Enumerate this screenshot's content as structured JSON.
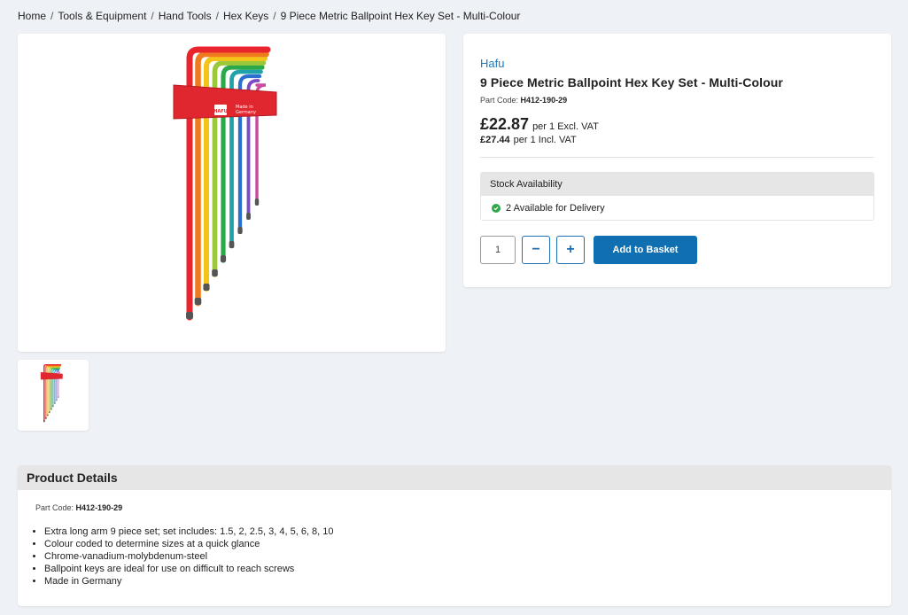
{
  "breadcrumb": {
    "items": [
      "Home",
      "Tools & Equipment",
      "Hand Tools",
      "Hex Keys"
    ],
    "current": "9 Piece Metric Ballpoint Hex Key Set - Multi-Colour",
    "separator": "/"
  },
  "product": {
    "brand": "Hafu",
    "title": "9 Piece Metric Ballpoint Hex Key Set - Multi-Colour",
    "part_code_label": "Part Code:",
    "part_code": "H412-190-29",
    "price_excl": "£22.87",
    "price_excl_unit": "per 1 Excl. VAT",
    "price_incl": "£27.44",
    "price_incl_unit": "per 1 Incl. VAT"
  },
  "stock": {
    "header": "Stock Availability",
    "status": "2 Available for Delivery",
    "status_color": "#2ea84a"
  },
  "basket": {
    "quantity": "1",
    "minus_label": "−",
    "plus_label": "+",
    "add_label": "Add to Basket",
    "accent": "#0f6fb0"
  },
  "details": {
    "header": "Product Details",
    "part_code_label": "Part Code:",
    "part_code": "H412-190-29",
    "bullets": [
      "Extra long arm 9 piece set; set includes: 1.5, 2, 2.5, 3, 4, 5, 6, 8, 10",
      "Colour coded to determine sizes at a quick glance",
      "Chrome-vanadium-molybdenum-steel",
      "Ballpoint keys are ideal for use on difficult to reach screws",
      "Made in Germany"
    ]
  },
  "image": {
    "holder_label_1": "Made in",
    "holder_label_2": "Germany",
    "holder_brand": "HAFU",
    "key_colors": [
      "#e8242d",
      "#f07a1e",
      "#f3c51a",
      "#9cc93b",
      "#2aa84a",
      "#1fa2a8",
      "#2b6fd0",
      "#7a4bc4",
      "#c94aa0"
    ]
  }
}
